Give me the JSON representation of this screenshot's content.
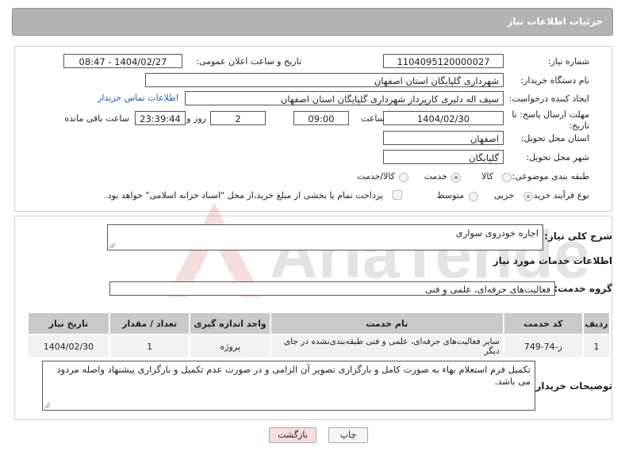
{
  "header": {
    "title": "جزئیات اطلاعات نیاز"
  },
  "form": {
    "need_number_label": "شماره نیاز:",
    "need_number": "1104095120000027",
    "announce_label": "تاریخ و ساعت اعلان عمومی:",
    "announce_value": "1404/02/27 - 08:47",
    "buyer_org_label": "نام دستگاه خریدار:",
    "buyer_org": "شهرداری گلپایگان استان اصفهان",
    "requester_label": "ایجاد کننده درخواست:",
    "requester": "سیف اله دلیری کارپرداز شهرداری گلپایگان استان اصفهان",
    "contact_link": "اطلاعات تماس خریدار",
    "deadline_label_line1": "مهلت ارسال پاسخ: تا",
    "deadline_label_line2": "تاریخ:",
    "deadline_date": "1404/02/30",
    "time_label": "ساعت",
    "deadline_time": "09:00",
    "days_value": "2",
    "days_label": "روز و",
    "remaining_time": "23:39:44",
    "remaining_label": "ساعت باقی مانده",
    "province_label": "استان محل تحویل:",
    "province": "اصفهان",
    "city_label": "شهر محل تحویل:",
    "city": "گلپایگان",
    "category_label": "طبقه بندی موضوعی:",
    "category_options": [
      "کالا",
      "خدمت",
      "کالا/خدمت"
    ],
    "category_selected": "خدمت",
    "process_label": "نوع فرآیند خرید :",
    "process_options": [
      "جزیی",
      "متوسط"
    ],
    "process_selected": "جزیی",
    "payment_note": "پرداخت تمام یا بخشی از مبلغ خرید،از محل \"اسناد خزانه اسلامی\" خواهد بود."
  },
  "summary": {
    "label": "شرح کلی نیاز:",
    "value": "اجاره خودروی سواری"
  },
  "services": {
    "section_title": "اطلاعات خدمات مورد نیاز",
    "group_label": "گروه خدمت:",
    "group_value": "فعالیت‌های حرفه‌ای، علمی و فنی",
    "columns": [
      "ردیف",
      "کد خدمت",
      "نام خدمت",
      "واحد اندازه گیری",
      "تعداد / مقدار",
      "تاریخ نیاز"
    ],
    "rows": [
      [
        "1",
        "ز-74-749",
        "سایر فعالیت‌های حرفه‌ای، علمی و فنی طبقه‌بندی‌نشده در جای دیگر",
        "پروژه",
        "1",
        "1404/02/30"
      ]
    ]
  },
  "buyer_notes": {
    "label": "توضیحات خریدار:",
    "value": "تکمیل فرم استعلام بهاء به صورت کامل و بارگزاری تصویر آن الزامی و در صورت عدم تکمیل و بارگزاری پیشنهاد واصله مردود می باشد."
  },
  "buttons": {
    "print": "چاپ",
    "back": "بازگشت"
  },
  "watermark_text": "AriaTender.neT",
  "colors": {
    "header_bg": "#b3b3b3",
    "link": "#1a5fb4",
    "back_button_bg": "#f6dede",
    "watermark": "#c0392b"
  }
}
